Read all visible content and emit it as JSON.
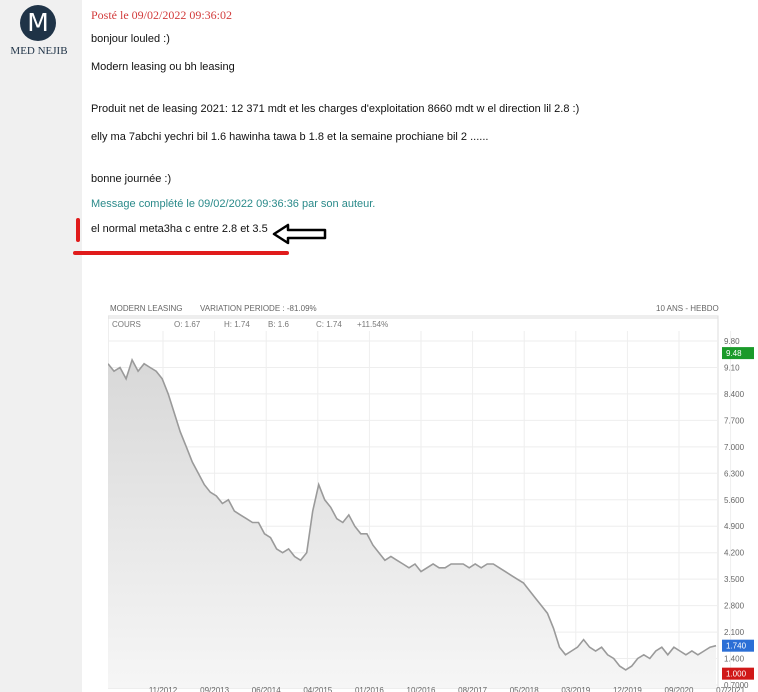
{
  "post": {
    "author_initial": "M",
    "author_name": "MED NEJIB",
    "posted_at": "Posté le 09/02/2022 09:36:02",
    "lines": [
      "bonjour louled :)",
      "Modern leasing ou bh leasing",
      "Produit net de leasing 2021: 12 371 mdt et les charges d'exploitation 8660 mdt w el direction lil 2.8 :)",
      "elly ma 7abchi yechri bil 1.6 hawinha tawa b 1.8 et la semaine prochiane bil 2 ......",
      "bonne journée :)"
    ],
    "completed_note": "Message complété le 09/02/2022 09:36:36 par son auteur.",
    "highlight_line": "el normal meta3ha c entre 2.8 et 3.5"
  },
  "colors": {
    "accent_red": "#e01b1b",
    "posted_red": "#d23c3c",
    "note_teal": "#2a8a8a",
    "avatar_bg": "#1f3347"
  },
  "chart_data": {
    "type": "area",
    "title": "MODERN LEASING",
    "variation_label": "VARIATION PERIODE : -81.09%",
    "period_label": "10 ANS - HEBDO",
    "legend": {
      "series": "COURS",
      "open": "O: 1.67",
      "high": "H: 1.74",
      "low": "B: 1.6",
      "close": "C: 1.74",
      "change": "+11.54%"
    },
    "y_ticks": [
      "9.80",
      "9.10",
      "8.400",
      "7.700",
      "7.000",
      "6.300",
      "5.600",
      "4.900",
      "4.200",
      "3.500",
      "2.800",
      "2.100",
      "1.400",
      "0.7000"
    ],
    "ylim": [
      0.7,
      9.8
    ],
    "badges": [
      {
        "label": "9.48",
        "value": 9.48,
        "color": "#1a9a2a"
      },
      {
        "label": "1.740",
        "value": 1.74,
        "color": "#2b6fd6"
      },
      {
        "label": "1.000",
        "value": 1.0,
        "color": "#d01818"
      }
    ],
    "x_labels": [
      "11/2012",
      "09/2013",
      "06/2014",
      "04/2015",
      "01/2016",
      "10/2016",
      "08/2017",
      "05/2018",
      "03/2019",
      "12/2019",
      "09/2020",
      "07/2021"
    ],
    "series": [
      {
        "values": [
          9.2,
          9.0,
          9.1,
          8.8,
          9.3,
          9.0,
          9.2,
          9.1,
          9.0,
          8.8,
          8.4,
          7.9,
          7.4,
          7.0,
          6.6,
          6.3,
          6.0,
          5.8,
          5.7,
          5.5,
          5.6,
          5.3,
          5.2,
          5.1,
          5.0,
          5.0,
          4.7,
          4.6,
          4.3,
          4.2,
          4.3,
          4.1,
          4.0,
          4.2,
          5.3,
          6.0,
          5.6,
          5.4,
          5.1,
          5.0,
          5.2,
          4.9,
          4.7,
          4.7,
          4.4,
          4.2,
          4.0,
          4.1,
          4.0,
          3.9,
          3.8,
          3.9,
          3.7,
          3.8,
          3.9,
          3.8,
          3.8,
          3.9,
          3.9,
          3.9,
          3.8,
          3.9,
          3.8,
          3.9,
          3.9,
          3.8,
          3.7,
          3.6,
          3.5,
          3.4,
          3.2,
          3.0,
          2.8,
          2.6,
          2.2,
          1.7,
          1.5,
          1.6,
          1.7,
          1.9,
          1.7,
          1.6,
          1.7,
          1.5,
          1.4,
          1.2,
          1.1,
          1.2,
          1.4,
          1.5,
          1.4,
          1.6,
          1.7,
          1.5,
          1.7,
          1.6,
          1.5,
          1.6,
          1.5,
          1.6,
          1.7,
          1.74
        ]
      }
    ]
  }
}
